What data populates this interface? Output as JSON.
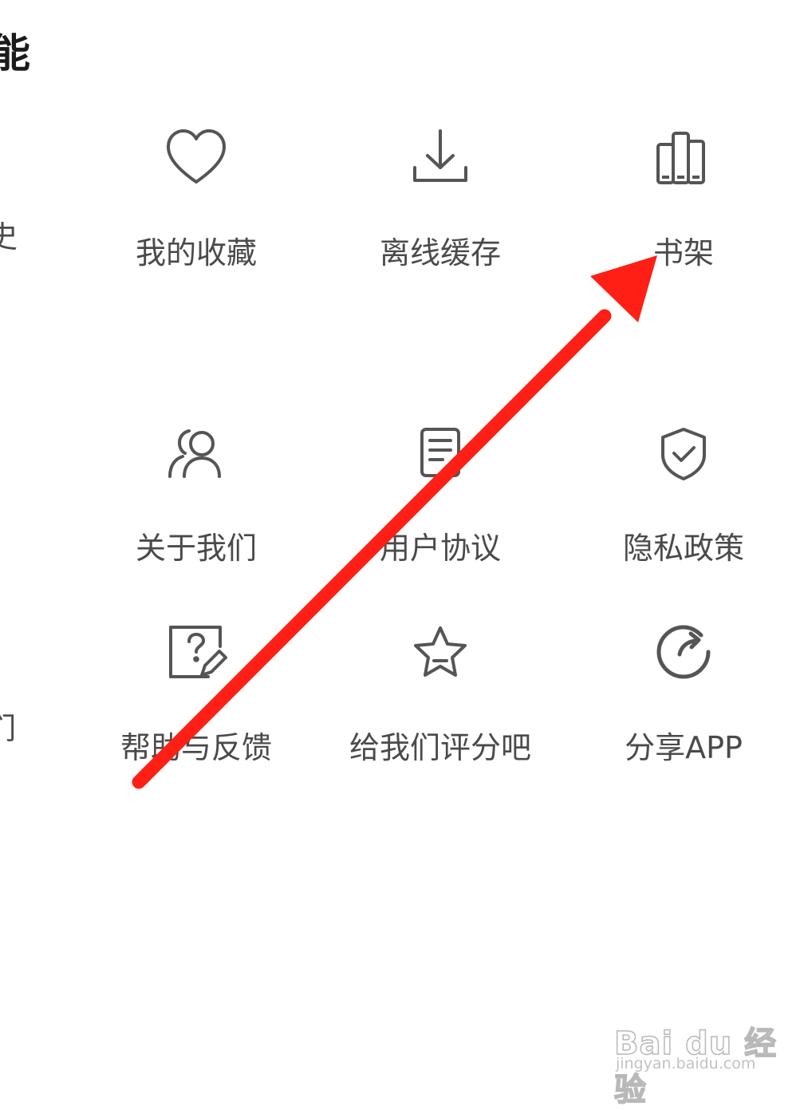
{
  "section": {
    "title": "能"
  },
  "partial_labels": {
    "row1": "史",
    "row3": "们"
  },
  "grid": [
    {
      "label": "我的收藏",
      "icon": "heart-icon"
    },
    {
      "label": "离线缓存",
      "icon": "download-icon"
    },
    {
      "label": "书架",
      "icon": "bookshelf-icon"
    },
    {
      "label": "关于我们",
      "icon": "users-icon"
    },
    {
      "label": "用户协议",
      "icon": "document-icon"
    },
    {
      "label": "隐私政策",
      "icon": "shield-check-icon"
    },
    {
      "label": "帮助与反馈",
      "icon": "help-feedback-icon"
    },
    {
      "label": "给我们评分吧",
      "icon": "star-icon"
    },
    {
      "label": "分享APP",
      "icon": "share-icon"
    }
  ],
  "watermark": {
    "logo": "Bai du 经验",
    "url": "jingyan.baidu.com"
  },
  "colors": {
    "icon_stroke": "#555555",
    "label": "#4a4a4a",
    "arrow": "#ff1f14"
  }
}
